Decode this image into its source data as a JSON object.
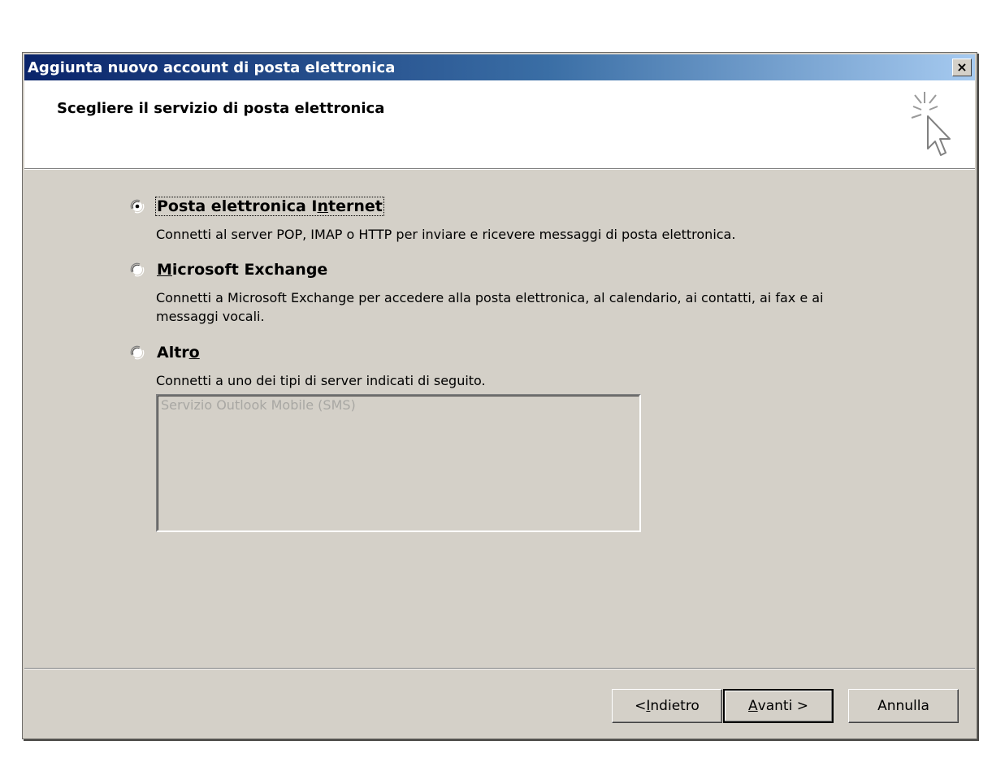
{
  "dialog": {
    "title": "Aggiunta nuovo account di posta elettronica",
    "close_glyph": "×",
    "header_title": "Scegliere il servizio di posta elettronica",
    "header_graphic_icon": "cursor-sparkle-icon"
  },
  "options": [
    {
      "label_pre": "Posta elettronica I",
      "label_mnemonic": "n",
      "label_post": "ternet",
      "description": "Connetti al server POP, IMAP o HTTP per inviare e ricevere messaggi di posta elettronica.",
      "selected": true
    },
    {
      "label_pre": "",
      "label_mnemonic": "M",
      "label_post": "icrosoft Exchange",
      "description_line1": "Connetti a Microsoft Exchange per accedere alla posta elettronica, al calendario, ai contatti, ai fax e ai",
      "description_line2": "messaggi vocali.",
      "selected": false
    },
    {
      "label_pre": "Altr",
      "label_mnemonic": "o",
      "label_post": "",
      "description": "Connetti a uno dei tipi di server indicati di seguito.",
      "selected": false
    }
  ],
  "server_list": {
    "items": [
      "Servizio Outlook Mobile (SMS)"
    ]
  },
  "buttons": {
    "back_pre": "< ",
    "back_mnemonic": "I",
    "back_post": "ndietro",
    "next_pre": "",
    "next_mnemonic": "A",
    "next_post": "vanti >",
    "cancel": "Annulla"
  },
  "colors": {
    "dialog_face": "#d4d0c8",
    "title_gradient_start": "#0a246a",
    "title_gradient_end": "#a6caf0",
    "disabled_text": "#a8a7a3"
  }
}
